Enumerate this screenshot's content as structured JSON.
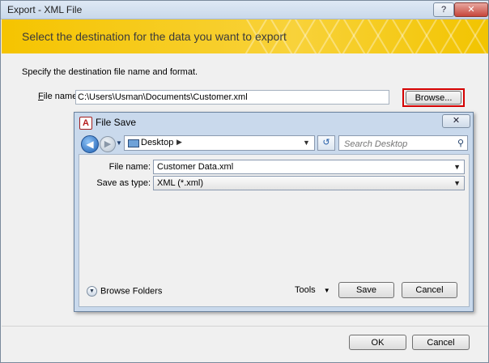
{
  "window": {
    "title": "Export - XML File",
    "help_label": "?",
    "close_label": "✕"
  },
  "banner": {
    "text": "Select the destination for the data you want to export"
  },
  "main": {
    "spec_text": "Specify the destination file name and format.",
    "file_name_label_prefix": "F",
    "file_name_label_rest": "ile name:",
    "file_name_value": "C:\\Users\\Usman\\Documents\\Customer.xml",
    "browse_label": "Browse..."
  },
  "file_save": {
    "title": "File Save",
    "app_icon_letter": "A",
    "close_label": "✕",
    "address": {
      "location": "Desktop",
      "separator": "▶",
      "dropdown": "▼"
    },
    "search_placeholder": "Search Desktop",
    "file_name_label": "File name:",
    "file_name_value": "Customer Data.xml",
    "save_type_label": "Save as type:",
    "save_type_value": "XML (*.xml)",
    "browse_folders_label": "Browse Folders",
    "tools_label": "Tools",
    "save_label": "Save",
    "cancel_label": "Cancel"
  },
  "footer": {
    "ok_label": "OK",
    "cancel_label": "Cancel"
  },
  "colors": {
    "banner": "#f5c400",
    "highlight": "#d40000",
    "inner_frame": "#c9d9ec"
  }
}
